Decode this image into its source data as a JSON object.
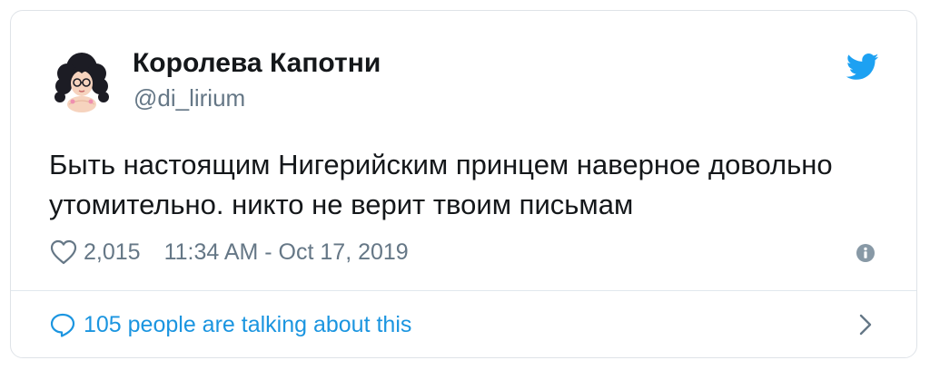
{
  "tweet": {
    "display_name": "Королева Капотни",
    "handle": "@di_lirium",
    "text_lines": [
      "Быть настоящим Нигерийским принцем наверное довольно",
      "утомительно. никто не верит твоим письмам"
    ],
    "likes": "2,015",
    "timestamp": "11:34 AM - Oct 17, 2019",
    "talking_label": "105 people are talking about this"
  },
  "icons": {
    "brand": "twitter-bird-icon",
    "like": "heart-icon",
    "info": "info-icon",
    "reply": "speech-bubble-icon",
    "more": "chevron-right-icon"
  },
  "colors": {
    "twitter_blue": "#1da1f2",
    "link_blue": "#1b95e0",
    "text_primary": "#14171a",
    "text_secondary": "#657786",
    "border": "#dfe3e8",
    "icon_gray": "#8899a6"
  }
}
